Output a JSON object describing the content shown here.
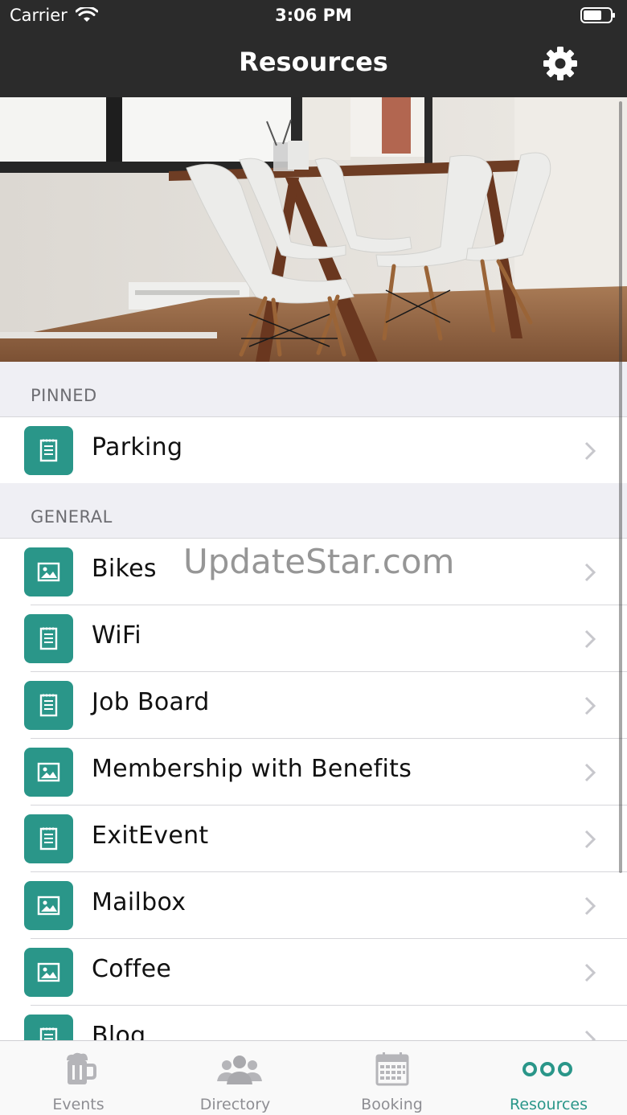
{
  "status_bar": {
    "carrier": "Carrier",
    "time": "3:06 PM"
  },
  "header": {
    "title": "Resources",
    "settings_icon": "gear-icon"
  },
  "sections": {
    "pinned": {
      "title": "PINNED",
      "items": [
        {
          "label": "Parking",
          "icon": "document-icon"
        }
      ]
    },
    "general": {
      "title": "GENERAL",
      "items": [
        {
          "label": "Bikes",
          "icon": "image-icon"
        },
        {
          "label": "WiFi",
          "icon": "document-icon"
        },
        {
          "label": "Job Board",
          "icon": "document-icon"
        },
        {
          "label": "Membership with Benefits",
          "icon": "image-icon"
        },
        {
          "label": "ExitEvent",
          "icon": "document-icon"
        },
        {
          "label": "Mailbox",
          "icon": "image-icon"
        },
        {
          "label": "Coffee",
          "icon": "image-icon"
        },
        {
          "label": "Blog",
          "icon": "document-icon"
        }
      ]
    }
  },
  "watermark": "UpdateStar.com",
  "tabs": [
    {
      "label": "Events",
      "icon": "beer-mug-icon",
      "active": false
    },
    {
      "label": "Directory",
      "icon": "people-icon",
      "active": false
    },
    {
      "label": "Booking",
      "icon": "calendar-icon",
      "active": false
    },
    {
      "label": "Resources",
      "icon": "more-dots-icon",
      "active": true
    }
  ],
  "colors": {
    "header_bg": "#2b2b2b",
    "accent": "#2a9689",
    "section_bg": "#efeff4",
    "tab_inactive": "#8e8e93"
  }
}
